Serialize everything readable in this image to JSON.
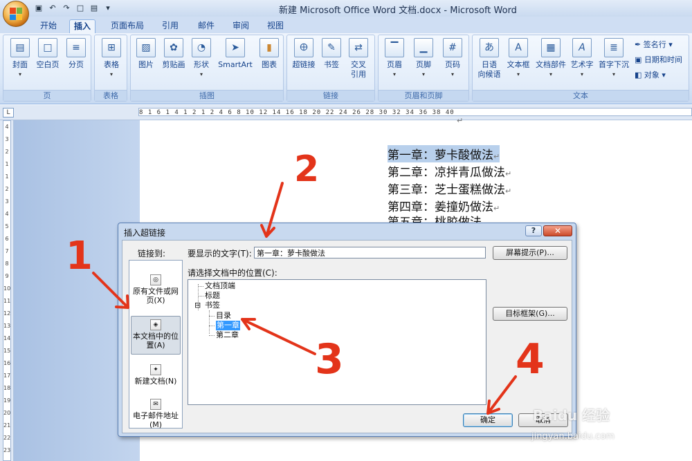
{
  "window": {
    "title": "新建 Microsoft Office Word 文档.docx - Microsoft Word"
  },
  "tabs": [
    "开始",
    "插入",
    "页面布局",
    "引用",
    "邮件",
    "审阅",
    "视图"
  ],
  "active_tab": "插入",
  "ribbon": {
    "pages": {
      "label": "页",
      "buttons": [
        "封面",
        "空白页",
        "分页"
      ]
    },
    "tables": {
      "label": "表格",
      "buttons": [
        "表格"
      ]
    },
    "illustrations": {
      "label": "插图",
      "buttons": [
        "图片",
        "剪贴画",
        "形状",
        "SmartArt",
        "图表"
      ]
    },
    "links": {
      "label": "链接",
      "buttons": [
        "超链接",
        "书签",
        "交叉",
        "引用"
      ]
    },
    "header_footer": {
      "label": "页眉和页脚",
      "buttons": [
        "页眉",
        "页脚",
        "页码"
      ]
    },
    "text": {
      "label": "文本",
      "buttons": [
        "日语",
        "向候语",
        "文本框",
        "文档部件",
        "艺术字",
        "首字下沉"
      ],
      "small": [
        "签名行",
        "日期和时间",
        "对象"
      ]
    }
  },
  "ruler": {
    "horizontal": "8 1 6 1 4 1 2 1 2 4 6 8 10 12 14 16 18 20 22 24 26 28 30 32 34 36 38 40",
    "vertical": [
      "4",
      "3",
      "2",
      "1",
      "1",
      "2",
      "3",
      "4",
      "5",
      "6",
      "7",
      "8",
      "9",
      "10",
      "11",
      "12",
      "13",
      "14",
      "15",
      "16",
      "17",
      "18",
      "19",
      "20",
      "21",
      "22",
      "23"
    ],
    "corner": "L"
  },
  "document": {
    "lines": [
      "第一章：萝卡酸做法",
      "第二章：凉拌青瓜做法",
      "第三章：芝士蛋糕做法",
      "第四章：姜撞奶做法",
      "第五章：桃胶做法"
    ],
    "paragraph_mark": "↵"
  },
  "dialog": {
    "title": "插入超链接",
    "help": "?",
    "close": "✕",
    "link_to_label": "链接到:",
    "display_text_label": "要显示的文字(T):",
    "display_text_value": "第一章：萝卡酸做法",
    "screentip_button": "屏幕提示(P)...",
    "location_label": "请选择文档中的位置(C):",
    "link_targets": [
      "原有文件或网页(X)",
      "本文档中的位置(A)",
      "新建文档(N)",
      "电子邮件地址(M)"
    ],
    "tree": [
      "文档顶端",
      "标题",
      "书签",
      "目录",
      "第一章",
      "第二章"
    ],
    "target_frame_button": "目标框架(G)...",
    "ok_button": "确定",
    "cancel_button": "取消"
  },
  "annotations": [
    "1",
    "2",
    "3",
    "4"
  ],
  "watermark": {
    "brand": "Baidu 经验",
    "url": "jingyan.baidu.com"
  }
}
